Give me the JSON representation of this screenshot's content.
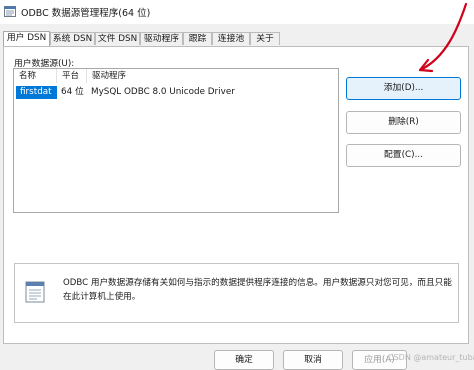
{
  "window": {
    "title": "ODBC 数据源管理程序(64 位)"
  },
  "tabs": [
    {
      "label": "用户 DSN",
      "active": true
    },
    {
      "label": "系统 DSN",
      "active": false
    },
    {
      "label": "文件 DSN",
      "active": false
    },
    {
      "label": "驱动程序",
      "active": false
    },
    {
      "label": "跟踪",
      "active": false
    },
    {
      "label": "连接池",
      "active": false
    },
    {
      "label": "关于",
      "active": false
    }
  ],
  "user_dsn": {
    "group_label": "用户数据源(U):",
    "columns": [
      "名称",
      "平台",
      "驱动程序"
    ],
    "rows": [
      {
        "name": "firstdat",
        "platform": "64 位",
        "driver": "MySQL ODBC 8.0 Unicode Driver",
        "selected": true
      }
    ],
    "buttons": {
      "add": "添加(D)...",
      "remove": "删除(R)",
      "configure": "配置(C)..."
    },
    "info_text": "ODBC 用户数据源存储有关如何与指示的数据提供程序连接的信息。用户数据源只对您可见，而且只能在此计算机上使用。"
  },
  "footer": {
    "ok": "确定",
    "cancel": "取消",
    "apply": "应用(A)",
    "watermark": "CSDN @amateur_tubai"
  },
  "colors": {
    "selection": "#0078d7",
    "annotation_arrow": "#d0021b"
  },
  "icons": {
    "app": "odbc-app-icon",
    "info": "document-info-icon"
  }
}
